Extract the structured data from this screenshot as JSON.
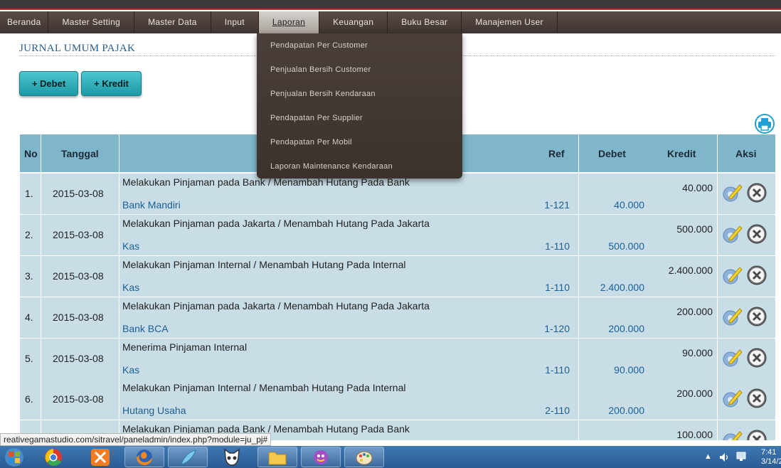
{
  "nav": {
    "items": [
      "Beranda",
      "Master Setting",
      "Master Data",
      "Input",
      "Laporan",
      "Keuangan",
      "Buku Besar",
      "Manajemen User"
    ],
    "active": "Laporan"
  },
  "dropdown": {
    "items": [
      "Pendapatan Per Customer",
      "Penjualan Bersih Customer",
      "Penjualan Bersih Kendaraan",
      "Pendapatan Per Supplier",
      "Pendapatan Per Mobil",
      "Laporan Maintenance Kendaraan"
    ]
  },
  "page": {
    "title": "JURNAL UMUM PAJAK",
    "btn_debet": "+ Debet",
    "btn_kredit": "+ Kredit"
  },
  "table": {
    "headers": {
      "no": "No",
      "tanggal": "Tanggal",
      "ref": "Ref",
      "debet": "Debet",
      "kredit": "Kredit",
      "aksi": "Aksi"
    },
    "rows": [
      {
        "no": "1.",
        "tanggal": "2015-03-08",
        "keterangan": "Melakukan Pinjaman pada Bank / Menambah Hutang Pada Bank",
        "akun": "Bank Mandiri",
        "ref": "1-121",
        "debet": "40.000",
        "kredit": "40.000"
      },
      {
        "no": "2.",
        "tanggal": "2015-03-08",
        "keterangan": "Melakukan Pinjaman pada Jakarta / Menambah Hutang Pada Jakarta",
        "akun": "Kas",
        "ref": "1-110",
        "debet": "500.000",
        "kredit": "500.000"
      },
      {
        "no": "3.",
        "tanggal": "2015-03-08",
        "keterangan": "Melakukan Pinjaman Internal / Menambah Hutang Pada Internal",
        "akun": "Kas",
        "ref": "1-110",
        "debet": "2.400.000",
        "kredit": "2.400.000"
      },
      {
        "no": "4.",
        "tanggal": "2015-03-08",
        "keterangan": "Melakukan Pinjaman pada Jakarta / Menambah Hutang Pada Jakarta",
        "akun": "Bank BCA",
        "ref": "1-120",
        "debet": "200.000",
        "kredit": "200.000"
      },
      {
        "no": "5.",
        "tanggal": "2015-03-08",
        "keterangan": "Menerima Pinjaman Internal",
        "akun": "Kas",
        "ref": "1-110",
        "debet": "90.000",
        "kredit": "90.000"
      },
      {
        "no": "6.",
        "tanggal": "2015-03-08",
        "keterangan": "Melakukan Pinjaman Internal / Menambah Hutang Pada Internal",
        "akun": "Hutang Usaha",
        "ref": "2-110",
        "debet": "200.000",
        "kredit": "200.000"
      },
      {
        "no": "",
        "tanggal": "",
        "keterangan": "Melakukan Pinjaman pada Bank / Menambah Hutang Pada Bank",
        "akun": "",
        "ref": "",
        "debet": "",
        "kredit": "100.000"
      }
    ]
  },
  "statusbar": {
    "url": "reativegamastudio.com/sitravel/paneladmin/index.php?module=ju_pj#"
  },
  "taskbar": {
    "time": "7:41",
    "date": "3/14/2"
  }
}
